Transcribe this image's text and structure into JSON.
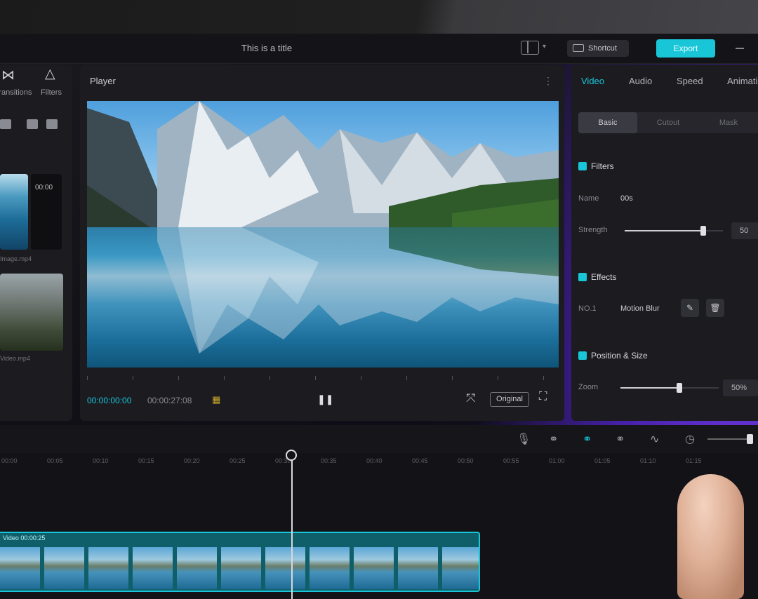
{
  "window": {
    "title": "This is a title"
  },
  "header": {
    "shortcut_label": "Shortcut",
    "export_label": "Export"
  },
  "left_panel": {
    "tabs": [
      {
        "label": "Transitions",
        "icon": "transition-icon"
      },
      {
        "label": "Filters",
        "icon": "filters-icon"
      }
    ],
    "media": [
      {
        "duration": "00:00",
        "caption": "Image.mp4"
      },
      {
        "caption": "Video.mp4"
      }
    ]
  },
  "player": {
    "title": "Player",
    "current_time": "00:00:00:00",
    "total_time": "00:00:27:08",
    "ratio_label": "Original"
  },
  "inspector": {
    "tabs": [
      "Video",
      "Audio",
      "Speed",
      "Animation"
    ],
    "active_tab": "Video",
    "subtabs": [
      "Basic",
      "Cutout",
      "Mask"
    ],
    "active_subtab": "Basic",
    "filters": {
      "title": "Filters",
      "name_label": "Name",
      "name_value": "00s",
      "strength_label": "Strength",
      "strength_value": "50",
      "strength_level": 0.8
    },
    "effects": {
      "title": "Effects",
      "fx_label": "NO.1",
      "fx_value": "Motion Blur"
    },
    "position_size": {
      "title": "Position & Size",
      "zoom_label": "Zoom",
      "zoom_value": "50%",
      "zoom_level": 0.6
    }
  },
  "timeline": {
    "marks": [
      "00:00",
      "00:05",
      "00:10",
      "00:15",
      "00:20",
      "00:25",
      "00:30",
      "00:35",
      "00:40",
      "00:45",
      "00:50",
      "00:55",
      "01:00",
      "01:05",
      "01:10",
      "01:15"
    ],
    "clip_label": "Video 00:00:25",
    "zoom_level": 0.88
  },
  "colors": {
    "accent": "#19c6d8",
    "glow": "#6a36d8"
  }
}
